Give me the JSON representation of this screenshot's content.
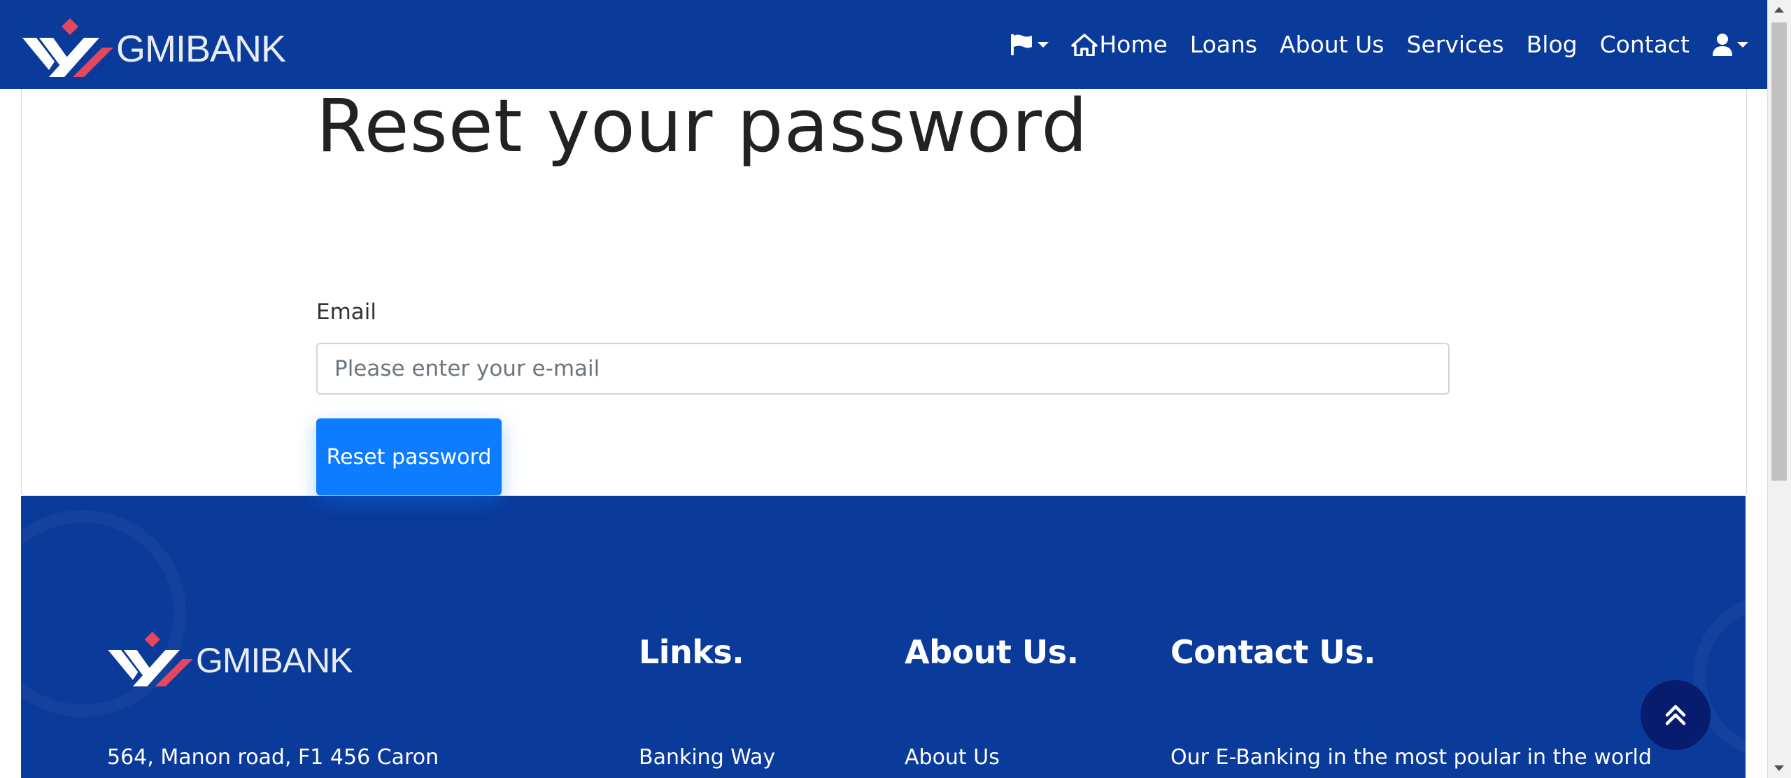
{
  "brand": {
    "name": "GMIBANK",
    "logo_icon": "gmibank-logo-icon"
  },
  "nav": {
    "language_icon": "flag-icon",
    "home_icon": "home-icon",
    "items": [
      "Home",
      "Loans",
      "About Us",
      "Services",
      "Blog",
      "Contact"
    ],
    "account_icon": "user-icon"
  },
  "page": {
    "title": "Reset your password",
    "email_label": "Email",
    "email_placeholder": "Please enter your e-mail",
    "email_value": "",
    "submit_label": "Reset password"
  },
  "footer": {
    "brand": "GMIBANK",
    "address": "564, Manon road, F1 456 Caron",
    "links_heading": "Links.",
    "links_first": "Banking Way",
    "about_heading": "About Us.",
    "about_first": "About Us",
    "contact_heading": "Contact Us.",
    "contact_text": "Our E-Banking in the most poular in the world"
  },
  "scroll_top_icon": "double-chevron-up-icon",
  "colors": {
    "navbar_bg": "#0a3a9a",
    "footer_bg": "#0a3a9a",
    "primary_button": "#0d7cff",
    "logo_accent": "#e5475e",
    "scroll_top_bg": "#071c6e"
  }
}
